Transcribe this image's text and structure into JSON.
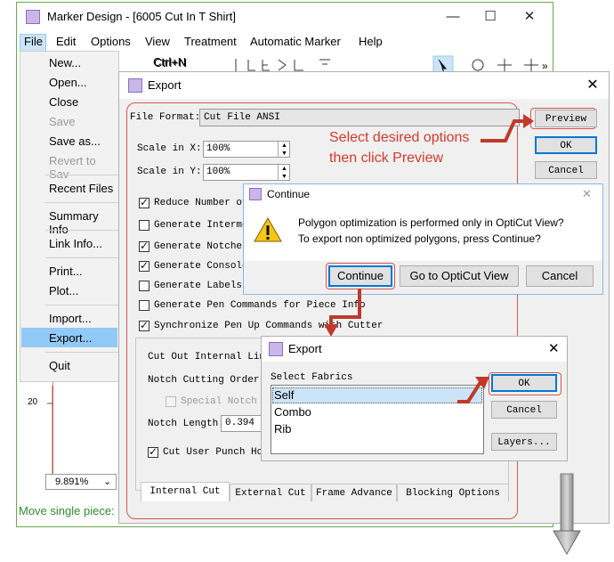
{
  "main_window": {
    "title": "Marker Design - [6005 Cut In T Shirt]",
    "controls": {
      "minimize": "—",
      "maximize": "☐",
      "close": "✕"
    },
    "menus": [
      "File",
      "Edit",
      "Options",
      "View",
      "Treatment",
      "Automatic Marker",
      "Help"
    ],
    "status": "Move single piece:",
    "zoom": "9.891%",
    "ruler_number": "20"
  },
  "file_menu": {
    "items": [
      {
        "label": "New...",
        "shortcut": "Ctrl+N",
        "disabled": false
      },
      {
        "label": "Open...",
        "shortcut": "",
        "disabled": false
      },
      {
        "label": "Close",
        "shortcut": "",
        "disabled": false
      },
      {
        "label": "Save",
        "shortcut": "",
        "disabled": true
      },
      {
        "label": "Save as...",
        "shortcut": "",
        "disabled": false
      },
      {
        "label": "Revert to Sav",
        "shortcut": "",
        "disabled": true
      },
      {
        "label": "Recent Files",
        "shortcut": "",
        "disabled": false
      },
      {
        "label": "Summary Info",
        "shortcut": "",
        "disabled": false
      },
      {
        "label": "Link Info...",
        "shortcut": "",
        "disabled": false
      },
      {
        "label": "Print...",
        "shortcut": "",
        "disabled": false
      },
      {
        "label": "Plot...",
        "shortcut": "",
        "disabled": false
      },
      {
        "label": "Import...",
        "shortcut": "",
        "disabled": false
      },
      {
        "label": "Export...",
        "shortcut": "",
        "disabled": false
      },
      {
        "label": "Quit",
        "shortcut": "",
        "disabled": false
      }
    ]
  },
  "export_dialog": {
    "title": "Export",
    "close": "✕",
    "file_format_label": "File Format:",
    "file_format_value": "Cut File ANSI",
    "scale_x_label": "Scale in X:",
    "scale_x_value": "100%",
    "scale_y_label": "Scale in Y:",
    "scale_y_value": "100%",
    "buttons": {
      "preview": "Preview",
      "ok": "OK",
      "cancel": "Cancel"
    },
    "checkboxes": [
      {
        "label": "Reduce Number of",
        "checked": true
      },
      {
        "label": "Generate Interme",
        "checked": false
      },
      {
        "label": "Generate Notches",
        "checked": true
      },
      {
        "label": "Generate Console",
        "checked": true
      },
      {
        "label": "Generate Labels",
        "checked": false
      },
      {
        "label": "Generate Pen Commands for Piece Info",
        "checked": false
      },
      {
        "label": "Synchronize Pen Up Commands with Cutter",
        "checked": true
      }
    ],
    "group": {
      "cut_out_internal": "Cut Out Internal Line",
      "notch_cutting_order": "Notch Cutting Order:",
      "special_notch": "Special Notch T",
      "notch_length_label": "Notch Length:",
      "notch_length_value": "0.394",
      "cut_user_punch": "Cut User Punch Hol"
    },
    "tabs": [
      "Internal Cut",
      "External Cut",
      "Frame Advance",
      "Blocking Options"
    ]
  },
  "annotation": {
    "line1": "Select desired options",
    "line2": "then click Preview"
  },
  "continue_dialog": {
    "title": "Continue",
    "close": "✕",
    "message_line1": "Polygon optimization is performed only in OptiCut View?",
    "message_line2": "To export non optimized polygons, press Continue?",
    "buttons": [
      "Continue",
      "Go to OptiCut View",
      "Cancel"
    ]
  },
  "export_fabrics_dialog": {
    "title": "Export",
    "close": "✕",
    "list_label": "Select Fabrics",
    "fabrics": [
      "Self",
      "Combo",
      "Rib"
    ],
    "buttons": {
      "ok": "OK",
      "cancel": "Cancel",
      "layers": "Layers..."
    }
  },
  "colors": {
    "accent_red": "#d33a2c",
    "selection_blue": "#cce4f7",
    "status_green": "#2e8b2e"
  }
}
